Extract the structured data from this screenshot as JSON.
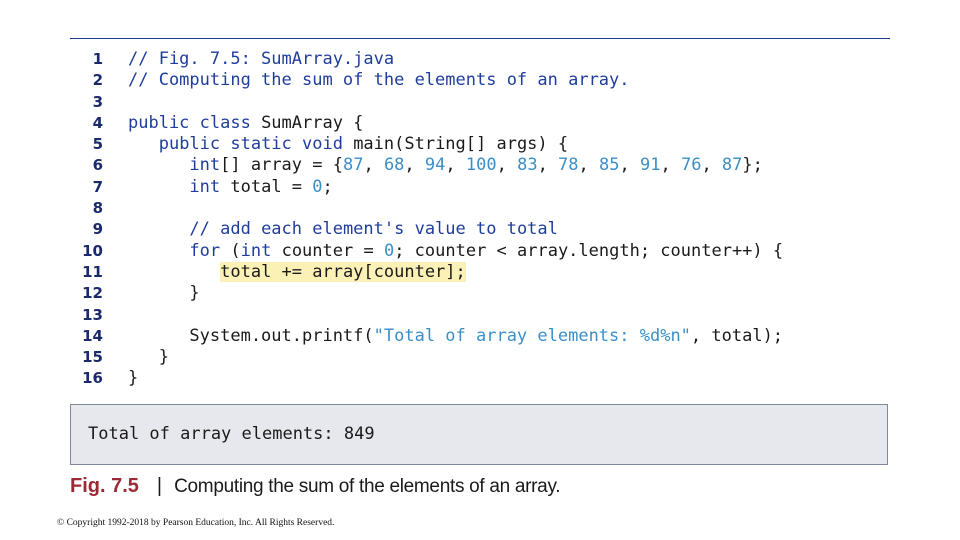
{
  "colors": {
    "keyword": "#1f3d9c",
    "comment": "#1f3d9c",
    "number": "#3a8fc8",
    "string": "#3a8fc8",
    "plain": "#1a1a1a",
    "line_number": "#1b2a6b",
    "highlight": "#fbf0b5",
    "rule": "#1b3c8f",
    "output_bg": "#e7e8ed",
    "caption_number": "#9b2a35"
  },
  "code_lines": [
    {
      "no": "1",
      "highlight": false,
      "tokens": [
        {
          "t": "// Fig. 7.5: SumArray.java",
          "c": "comment"
        }
      ]
    },
    {
      "no": "2",
      "highlight": false,
      "tokens": [
        {
          "t": "// Computing the sum of the elements of an array.",
          "c": "comment"
        }
      ]
    },
    {
      "no": "3",
      "highlight": false,
      "tokens": []
    },
    {
      "no": "4",
      "highlight": false,
      "tokens": [
        {
          "t": "public class ",
          "c": "keyword"
        },
        {
          "t": "SumArray {",
          "c": "plain"
        }
      ]
    },
    {
      "no": "5",
      "highlight": false,
      "tokens": [
        {
          "t": "   ",
          "c": "plain"
        },
        {
          "t": "public static void ",
          "c": "keyword"
        },
        {
          "t": "main(String[] args) {",
          "c": "plain"
        }
      ]
    },
    {
      "no": "6",
      "highlight": false,
      "tokens": [
        {
          "t": "      ",
          "c": "plain"
        },
        {
          "t": "int",
          "c": "keyword"
        },
        {
          "t": "[] array = {",
          "c": "plain"
        },
        {
          "t": "87",
          "c": "number"
        },
        {
          "t": ", ",
          "c": "plain"
        },
        {
          "t": "68",
          "c": "number"
        },
        {
          "t": ", ",
          "c": "plain"
        },
        {
          "t": "94",
          "c": "number"
        },
        {
          "t": ", ",
          "c": "plain"
        },
        {
          "t": "100",
          "c": "number"
        },
        {
          "t": ", ",
          "c": "plain"
        },
        {
          "t": "83",
          "c": "number"
        },
        {
          "t": ", ",
          "c": "plain"
        },
        {
          "t": "78",
          "c": "number"
        },
        {
          "t": ", ",
          "c": "plain"
        },
        {
          "t": "85",
          "c": "number"
        },
        {
          "t": ", ",
          "c": "plain"
        },
        {
          "t": "91",
          "c": "number"
        },
        {
          "t": ", ",
          "c": "plain"
        },
        {
          "t": "76",
          "c": "number"
        },
        {
          "t": ", ",
          "c": "plain"
        },
        {
          "t": "87",
          "c": "number"
        },
        {
          "t": "};",
          "c": "plain"
        }
      ]
    },
    {
      "no": "7",
      "highlight": false,
      "tokens": [
        {
          "t": "      ",
          "c": "plain"
        },
        {
          "t": "int ",
          "c": "keyword"
        },
        {
          "t": "total = ",
          "c": "plain"
        },
        {
          "t": "0",
          "c": "number"
        },
        {
          "t": ";",
          "c": "plain"
        }
      ]
    },
    {
      "no": "8",
      "highlight": false,
      "tokens": []
    },
    {
      "no": "9",
      "highlight": false,
      "tokens": [
        {
          "t": "      ",
          "c": "plain"
        },
        {
          "t": "// add each element's value to total",
          "c": "comment"
        }
      ]
    },
    {
      "no": "10",
      "highlight": false,
      "tokens": [
        {
          "t": "      ",
          "c": "plain"
        },
        {
          "t": "for ",
          "c": "keyword"
        },
        {
          "t": "(",
          "c": "plain"
        },
        {
          "t": "int ",
          "c": "keyword"
        },
        {
          "t": "counter = ",
          "c": "plain"
        },
        {
          "t": "0",
          "c": "number"
        },
        {
          "t": "; counter < array.length; counter++) {",
          "c": "plain"
        }
      ]
    },
    {
      "no": "11",
      "highlight": true,
      "tokens": [
        {
          "t": "         ",
          "c": "plain"
        },
        {
          "t": "total += array[counter];",
          "c": "plain",
          "hl": true
        }
      ]
    },
    {
      "no": "12",
      "highlight": false,
      "tokens": [
        {
          "t": "      }",
          "c": "plain"
        }
      ]
    },
    {
      "no": "13",
      "highlight": false,
      "tokens": []
    },
    {
      "no": "14",
      "highlight": false,
      "tokens": [
        {
          "t": "      System.out.printf(",
          "c": "plain"
        },
        {
          "t": "\"Total of array elements: %d%n\"",
          "c": "string"
        },
        {
          "t": ", total);",
          "c": "plain"
        }
      ]
    },
    {
      "no": "15",
      "highlight": false,
      "tokens": [
        {
          "t": "   }",
          "c": "plain"
        }
      ]
    },
    {
      "no": "16",
      "highlight": false,
      "tokens": [
        {
          "t": "}",
          "c": "plain"
        }
      ]
    }
  ],
  "output": {
    "text": "Total of array elements: 849"
  },
  "caption": {
    "number": "Fig. 7.5",
    "separator": "|",
    "text": "Computing the sum of the elements of an array."
  },
  "copyright": "© Copyright 1992-2018 by Pearson Education, Inc. All Rights Reserved."
}
